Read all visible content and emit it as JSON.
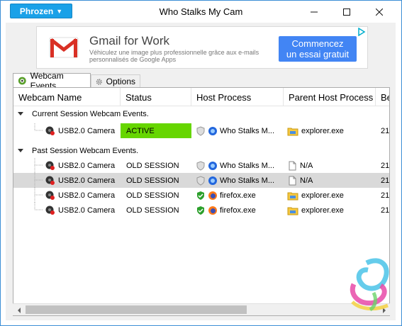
{
  "window": {
    "brand_label": "Phrozen",
    "title": "Who Stalks My Cam"
  },
  "ad": {
    "title": "Gmail for Work",
    "description": "Véhiculez une image plus professionnelle grâce aux e-mails personnalisés de Google Apps",
    "cta_line1": "Commencez",
    "cta_line2": "un essai gratuit"
  },
  "tabs": [
    {
      "label": "Webcam Events",
      "icon": "webcam-tab-icon",
      "selected": true
    },
    {
      "label": "Options",
      "icon": "gear-icon",
      "selected": false
    }
  ],
  "columns": [
    "Webcam Name",
    "Status",
    "Host Process",
    "Parent Host Process",
    "Be"
  ],
  "groups": [
    {
      "label": "Current Session Webcam Events."
    },
    {
      "label": "Past Session Webcam Events."
    }
  ],
  "rows": [
    {
      "webcam": "USB2.0 Camera",
      "status": "ACTIVE",
      "host": "Who Stalks M...",
      "parent": "explorer.exe",
      "be": "21"
    },
    {
      "webcam": "USB2.0 Camera",
      "status": "OLD SESSION",
      "host": "Who Stalks M...",
      "parent": "N/A",
      "be": "21"
    },
    {
      "webcam": "USB2.0 Camera",
      "status": "OLD SESSION",
      "host": "Who Stalks M...",
      "parent": "N/A",
      "be": "21"
    },
    {
      "webcam": "USB2.0 Camera",
      "status": "OLD SESSION",
      "host": "firefox.exe",
      "parent": "explorer.exe",
      "be": "21"
    },
    {
      "webcam": "USB2.0 Camera",
      "status": "OLD SESSION",
      "host": "firefox.exe",
      "parent": "explorer.exe",
      "be": "21"
    }
  ],
  "colors": {
    "brand": "#1aa1e8",
    "active_status": "#66d600",
    "selected_row": "#d9d9d9",
    "ad_button": "#4285f4"
  }
}
